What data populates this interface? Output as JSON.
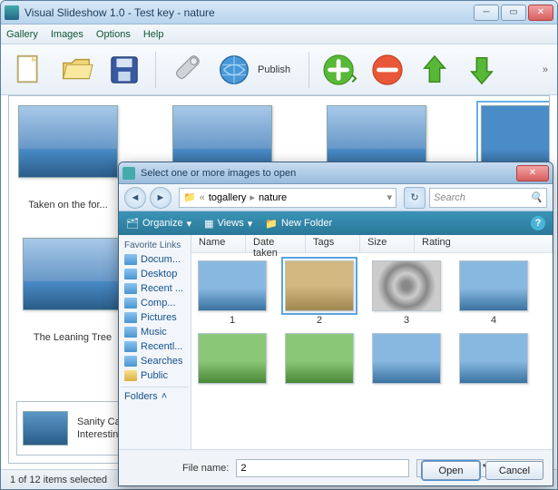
{
  "window": {
    "title": "Visual Slideshow 1.0 - Test key - nature"
  },
  "menu": {
    "gallery": "Gallery",
    "images": "Images",
    "options": "Options",
    "help": "Help"
  },
  "toolbar": {
    "publish": "Publish"
  },
  "gallery": {
    "thumbs": [
      {
        "caption": "Taken on the for..."
      },
      {
        "caption": ""
      },
      {
        "caption": ""
      },
      {
        "caption": ""
      }
    ],
    "row2_caption": "The Leaning Tree",
    "detail": {
      "line1": "Sanity Ca",
      "line2": "Interestin"
    }
  },
  "status": "1 of 12 items selected",
  "dialog": {
    "title": "Select one or more images to open",
    "breadcrumb": {
      "p1": "togallery",
      "p2": "nature"
    },
    "search_placeholder": "Search",
    "toolbar": {
      "organize": "Organize",
      "views": "Views",
      "newfolder": "New Folder"
    },
    "fav_header": "Favorite Links",
    "favs": [
      "Docum...",
      "Desktop",
      "Recent ...",
      "Comp...",
      "Pictures",
      "Music",
      "Recentl...",
      "Searches",
      "Public"
    ],
    "folders_label": "Folders",
    "columns": {
      "name": "Name",
      "date": "Date taken",
      "tags": "Tags",
      "size": "Size",
      "rating": "Rating"
    },
    "files": [
      "1",
      "2",
      "3",
      "4"
    ],
    "filename_label": "File name:",
    "filename_value": "2",
    "filter": "Images (*.bmp *.dib *.rle *.jpg *",
    "open": "Open",
    "cancel": "Cancel"
  }
}
